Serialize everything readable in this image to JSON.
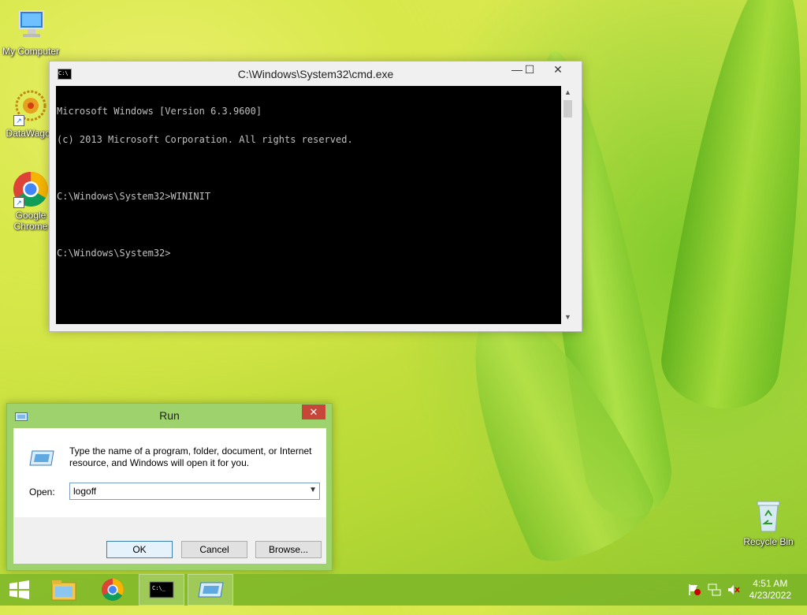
{
  "desktop": {
    "icons": [
      {
        "label": "My Computer"
      },
      {
        "label": "DataWagon"
      },
      {
        "label": "Google Chrome"
      },
      {
        "label": "Recycle Bin"
      }
    ]
  },
  "cmd": {
    "title": "C:\\Windows\\System32\\cmd.exe",
    "icon_text": "C:\\",
    "minimize": "—",
    "maximize": "☐",
    "close": "✕",
    "lines": [
      "Microsoft Windows [Version 6.3.9600]",
      "(c) 2013 Microsoft Corporation. All rights reserved.",
      "",
      "C:\\Windows\\System32>WININIT",
      "",
      "C:\\Windows\\System32>"
    ]
  },
  "run": {
    "title": "Run",
    "close": "✕",
    "description": "Type the name of a program, folder, document, or Internet resource, and Windows will open it for you.",
    "open_label": "Open:",
    "input_value": "logoff",
    "ok": "OK",
    "cancel": "Cancel",
    "browse": "Browse..."
  },
  "taskbar": {
    "clock_time": "4:51 AM",
    "clock_date": "4/23/2022"
  },
  "colors": {
    "accent": "#9ed26c",
    "close_red": "#c7463a",
    "console_bg": "#000000",
    "console_text": "#c0c0c0"
  }
}
